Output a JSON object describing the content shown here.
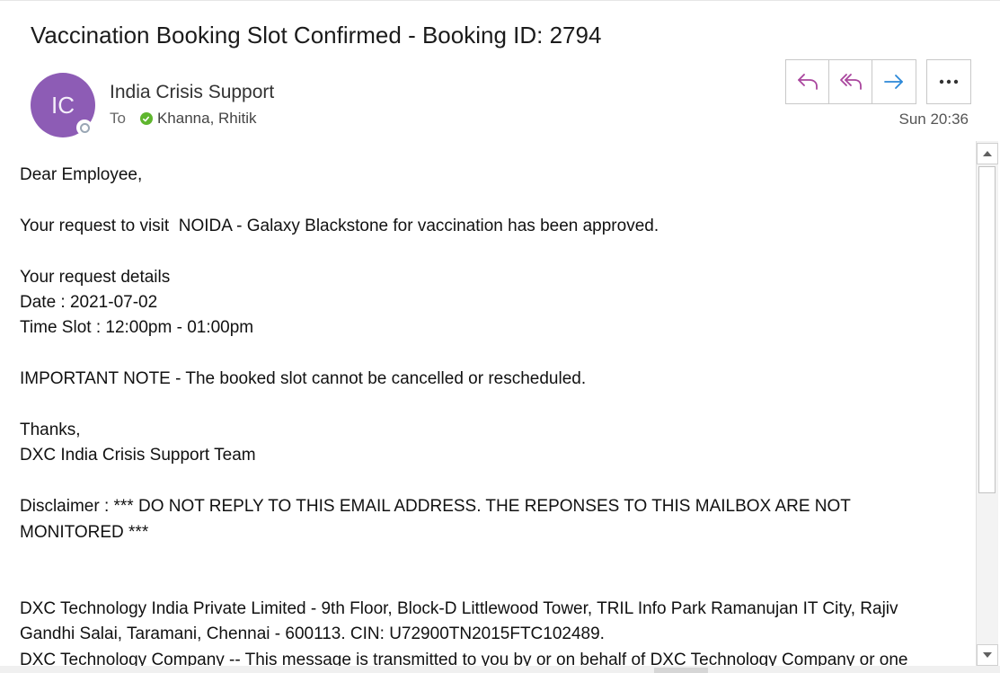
{
  "email": {
    "subject": "Vaccination Booking Slot Confirmed - Booking ID: 2794",
    "avatar_initials": "IC",
    "sender": "India Crisis Support",
    "to_label": "To",
    "recipient": "Khanna, Rhitik",
    "timestamp": "Sun 20:36",
    "body": {
      "greeting": "Dear Employee,",
      "approval": "Your request to visit  NOIDA - Galaxy Blackstone for vaccination has been approved.",
      "details_heading": "Your request details",
      "date_line": "Date : 2021-07-02",
      "time_line": "Time Slot : 12:00pm - 01:00pm",
      "note": "IMPORTANT NOTE - The booked slot cannot be cancelled or rescheduled.",
      "thanks": "Thanks,",
      "team": "DXC India Crisis Support Team",
      "disclaimer": "Disclaimer : *** DO NOT REPLY TO THIS EMAIL ADDRESS. THE REPONSES TO THIS MAILBOX ARE NOT MONITORED ***",
      "company_address": "DXC Technology India Private Limited - 9th Floor, Block-D Littlewood Tower, TRIL Info Park Ramanujan IT City, Rajiv Gandhi Salai, Taramani, Chennai - 600113. CIN: U72900TN2015FTC102489.",
      "legal_notice": "DXC Technology Company -- This message is transmitted to you by or on behalf of DXC Technology Company or one"
    }
  },
  "actions": {
    "reply_icon": "reply-icon",
    "reply_all_icon": "reply-all-icon",
    "forward_icon": "forward-icon",
    "more_icon": "more-icon"
  },
  "colors": {
    "avatar": "#8d5cb5",
    "reply_accent": "#a9459d",
    "forward_accent": "#2b88d8",
    "presence_available": "#5fb62e"
  }
}
